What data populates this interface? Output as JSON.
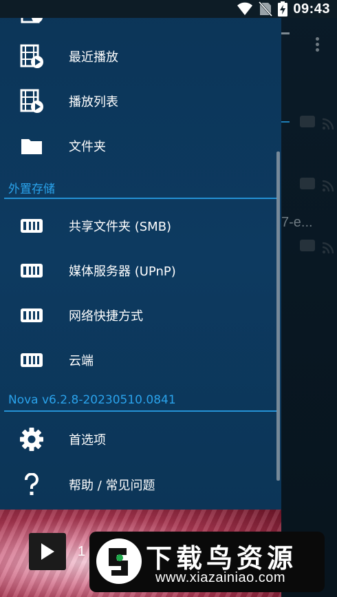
{
  "status_bar": {
    "time": "09:43",
    "icons": [
      "wifi-icon",
      "no-sim-icon",
      "battery-charging-icon"
    ]
  },
  "background": {
    "partial_text": "7-e..."
  },
  "drawer": {
    "top_items": [
      {
        "label": "最近播放",
        "icon": "recent-video-icon"
      },
      {
        "label": "播放列表",
        "icon": "playlist-video-icon"
      },
      {
        "label": "文件夹",
        "icon": "folder-icon"
      }
    ],
    "external_storage": {
      "header": "外置存储",
      "items": [
        {
          "label": "共享文件夹 (SMB)",
          "icon": "storage-server-icon"
        },
        {
          "label": "媒体服务器 (UPnP)",
          "icon": "storage-server-icon"
        },
        {
          "label": "网络快捷方式",
          "icon": "storage-server-icon"
        },
        {
          "label": "云端",
          "icon": "storage-server-icon"
        }
      ]
    },
    "version_section": {
      "header": "Nova v6.2.8-20230510.0841",
      "items": [
        {
          "label": "首选项",
          "icon": "gear-icon"
        },
        {
          "label": "帮助 / 常见问题",
          "icon": "question-mark-icon"
        }
      ]
    }
  },
  "player": {
    "title_partial": "1"
  },
  "watermark": {
    "title": "下载鸟资源",
    "url": "www.xiazainiao.com"
  },
  "colors": {
    "drawer_bg": "#0d3a60",
    "accent": "#2aa3ec",
    "divider": "#2593d6"
  }
}
